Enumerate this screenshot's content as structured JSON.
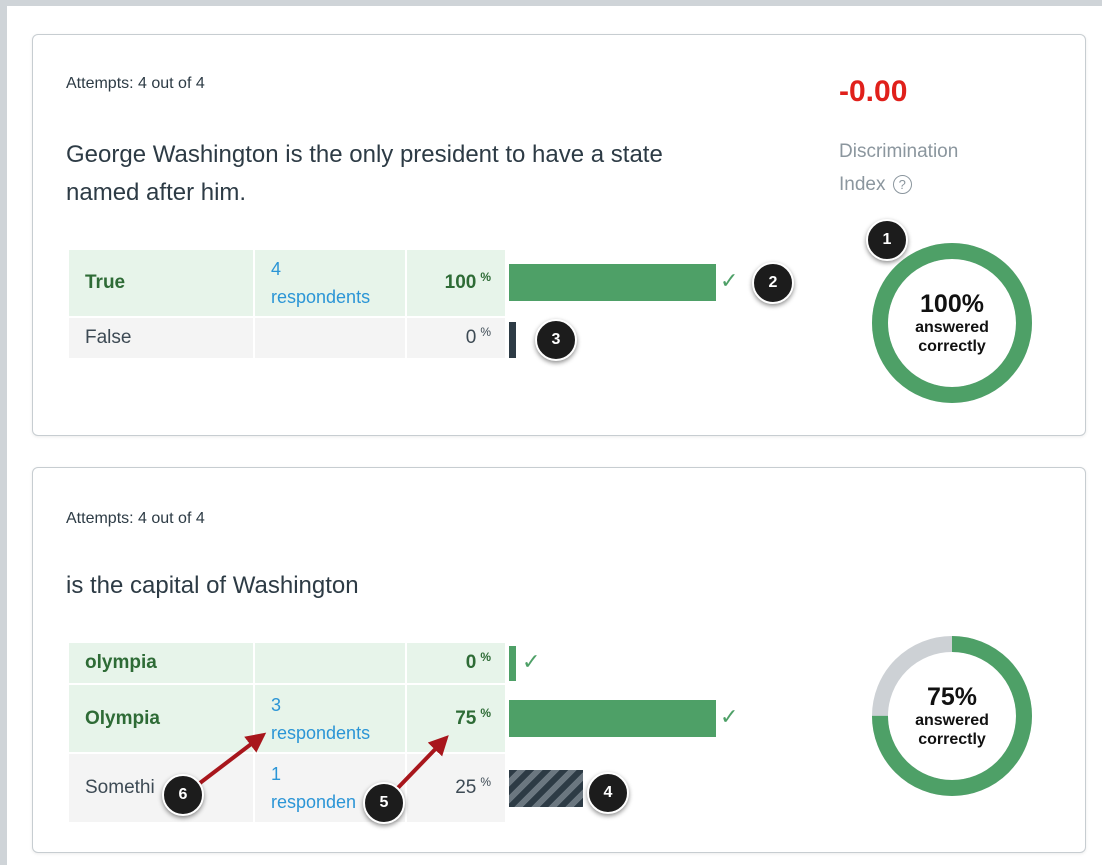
{
  "question1": {
    "attempts": "Attempts: 4 out of 4",
    "text": "George Washington is the only president to have a state named after him.",
    "discrimination_value": "-0.00",
    "discrimination_label_1": "Discrimination",
    "discrimination_label_2": "Index",
    "help_icon": "?",
    "answers": [
      {
        "label": "True",
        "respondents_count": "4",
        "respondents_word": "respondents",
        "percent": "100",
        "correct": true
      },
      {
        "label": "False",
        "respondents_count": "",
        "respondents_word": "",
        "percent": "0",
        "correct": false
      }
    ],
    "donut": {
      "percent_text": "100%",
      "line1": "answered",
      "line2": "correctly",
      "percent_value": 100
    }
  },
  "question2": {
    "attempts": "Attempts: 4 out of 4",
    "text": "is the capital of Washington",
    "answers": [
      {
        "label": "olympia",
        "respondents_count": "",
        "respondents_word": "",
        "percent": "0",
        "correct": true
      },
      {
        "label": "Olympia",
        "respondents_count": "3",
        "respondents_word": "respondents",
        "percent": "75",
        "correct": true
      },
      {
        "label": "Somethi    lse",
        "respondents_count": "1",
        "respondents_word": "responden",
        "percent": "25",
        "correct": false
      }
    ],
    "donut": {
      "percent_text": "75%",
      "line1": "answered",
      "line2": "correctly",
      "percent_value": 75
    }
  },
  "percent_sign": "%",
  "check_icon": "✓",
  "badges": [
    "1",
    "2",
    "3",
    "4",
    "5",
    "6"
  ],
  "colors": {
    "correct": "#4ea067",
    "score": "#e0201b",
    "respondents_link": "#2b95d6",
    "donut_remainder": "#cdd1d5",
    "annotation_arrow": "#a8161c"
  }
}
